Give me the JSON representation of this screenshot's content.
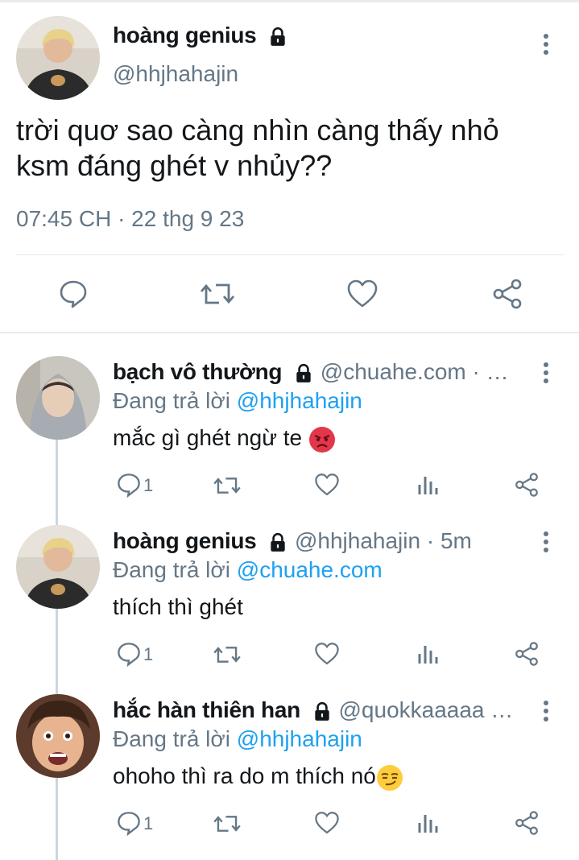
{
  "main_tweet": {
    "name": "hoàng genius",
    "handle": "@hhjhahajin",
    "text_line1": "trời quơ sao càng nhìn càng thấy nhỏ",
    "text_line2": "ksm đáng ghét v nhủy??",
    "timestamp": "07:45 CH · 22 thg 9 23",
    "actions": [
      "reply-icon",
      "retweet-icon",
      "like-icon",
      "share-icon"
    ]
  },
  "replies": [
    {
      "name": "bạch vô thường",
      "handle_meta": "@chuahe.com · …",
      "replying_prefix": "Đang trả lời",
      "replying_to": "@hhjhahajin",
      "text": "mắc gì ghét ngừ te",
      "emoji": "angry-face",
      "reply_count": "1"
    },
    {
      "name": "hoàng genius",
      "handle_meta": "@hhjhahajin · 5m",
      "replying_prefix": "Đang trả lời",
      "replying_to": "@chuahe.com",
      "text": "thích thì ghét",
      "emoji": "",
      "reply_count": "1"
    },
    {
      "name": "hắc hàn thiên han",
      "handle_meta": "@quokkaaaaa …",
      "replying_prefix": "Đang trả lời",
      "replying_to": "@hhjhahajin",
      "text": "ohoho thì ra do m thích nó",
      "emoji": "smirking-face",
      "reply_count": "1"
    }
  ],
  "colors": {
    "link": "#1da1f2",
    "secondary": "#657786",
    "icon": "#657786",
    "thread": "#ccd6dd"
  }
}
